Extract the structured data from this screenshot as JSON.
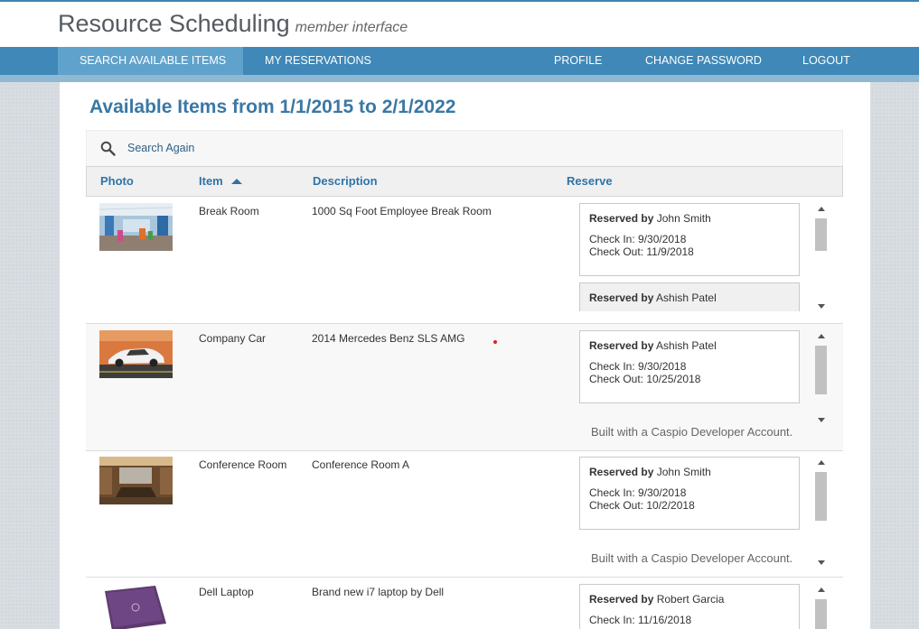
{
  "header": {
    "title": "Resource Scheduling",
    "subtitle": "member interface"
  },
  "nav": {
    "items": [
      {
        "label": "SEARCH AVAILABLE ITEMS",
        "active": true
      },
      {
        "label": "MY RESERVATIONS"
      },
      {
        "label": "PROFILE"
      },
      {
        "label": "CHANGE PASSWORD"
      },
      {
        "label": "LOGOUT"
      }
    ]
  },
  "page": {
    "title": "Available Items from 1/1/2015 to 2/1/2022",
    "search_again": "Search Again"
  },
  "table": {
    "columns": [
      "Photo",
      "Item",
      "Description",
      "Reserve"
    ],
    "sorted_column": "Item",
    "sort_direction": "ascending",
    "rows": [
      {
        "photo": "break-room-photo",
        "item": "Break Room",
        "description": "1000 Sq Foot Employee Break Room",
        "reservations": [
          {
            "by_label": "Reserved by",
            "by": "John Smith",
            "check_in": "Check In: 9/30/2018",
            "check_out": "Check Out: 11/9/2018"
          },
          {
            "by_label": "Reserved by",
            "by": "Ashish Patel"
          }
        ]
      },
      {
        "photo": "company-car-photo",
        "item": "Company Car",
        "description": "2014 Mercedes Benz SLS AMG",
        "reservations": [
          {
            "by_label": "Reserved by",
            "by": "Ashish Patel",
            "check_in": "Check In: 9/30/2018",
            "check_out": "Check Out: 10/25/2018"
          }
        ],
        "footer": "Built with a Caspio Developer Account."
      },
      {
        "photo": "conference-room-photo",
        "item": "Conference Room",
        "description": "Conference Room A",
        "reservations": [
          {
            "by_label": "Reserved by",
            "by": "John Smith",
            "check_in": "Check In: 9/30/2018",
            "check_out": "Check Out: 10/2/2018"
          }
        ],
        "footer": "Built with a Caspio Developer Account."
      },
      {
        "photo": "dell-laptop-photo",
        "item": "Dell Laptop",
        "description": "Brand new i7 laptop by Dell",
        "reservations": [
          {
            "by_label": "Reserved by",
            "by": "Robert Garcia",
            "check_in": "Check In: 11/16/2018"
          }
        ]
      }
    ]
  },
  "colors": {
    "accent": "#3f88b8",
    "nav_active": "#5fa2cc",
    "title_blue": "#3a78a5"
  }
}
